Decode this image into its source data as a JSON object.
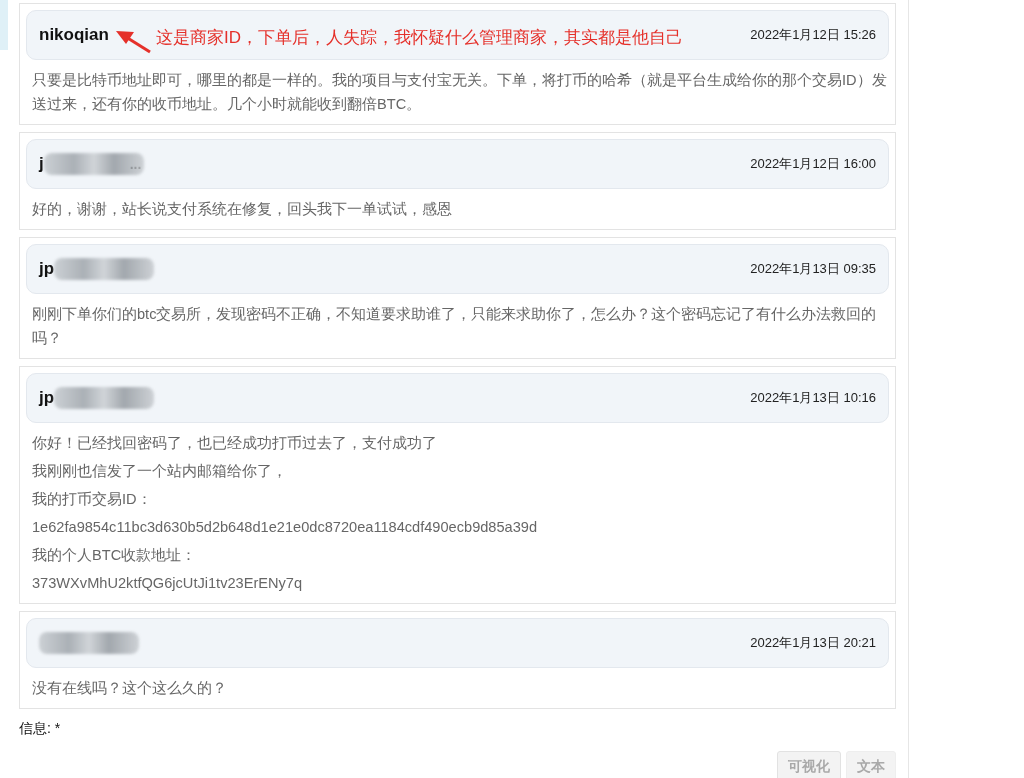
{
  "messages": [
    {
      "kind": "named",
      "author": "nikoqian",
      "time": "2022年1月12日 15:26",
      "paragraphs": [
        "只要是比特币地址即可，哪里的都是一样的。我的项目与支付宝无关。下单，将打币的哈希（就是平台生成给你的那个交易ID）发送过来，还有你的收币地址。几个小时就能收到翻倍BTC。"
      ]
    },
    {
      "kind": "masked",
      "author": "j",
      "name_suffix": "...",
      "time": "2022年1月12日 16:00",
      "paragraphs": [
        "好的，谢谢，站长说支付系统在修复，回头我下一单试试，感恩"
      ]
    },
    {
      "kind": "masked",
      "author": "jp",
      "time": "2022年1月13日 09:35",
      "paragraphs": [
        "刚刚下单你们的btc交易所，发现密码不正确，不知道要求助谁了，只能来求助你了，怎么办？这个密码忘记了有什么办法救回的吗？"
      ]
    },
    {
      "kind": "masked",
      "author": "jp",
      "time": "2022年1月13日 10:16",
      "paragraphs": [
        "你好！已经找回密码了，也已经成功打币过去了，支付成功了",
        "我刚刚也信发了一个站内邮箱给你了，",
        "我的打币交易ID：",
        "1e62fa9854c11bc3d630b5d2b648d1e21e0dc8720ea1184cdf490ecb9d85a39d",
        "我的个人BTC收款地址：",
        "373WXvMhU2ktfQG6jcUtJi1tv23ErENy7q"
      ]
    },
    {
      "kind": "masked",
      "time": "2022年1月13日 20:21",
      "paragraphs": [
        "没有在线吗？这个这么久的？"
      ]
    }
  ],
  "annotation": {
    "text": "这是商家ID，下单后，人失踪，我怀疑什么管理商家，其实都是他自己"
  },
  "form": {
    "label": "信息:",
    "required_mark": "*"
  },
  "buttons": [
    "可视化",
    "文本"
  ]
}
